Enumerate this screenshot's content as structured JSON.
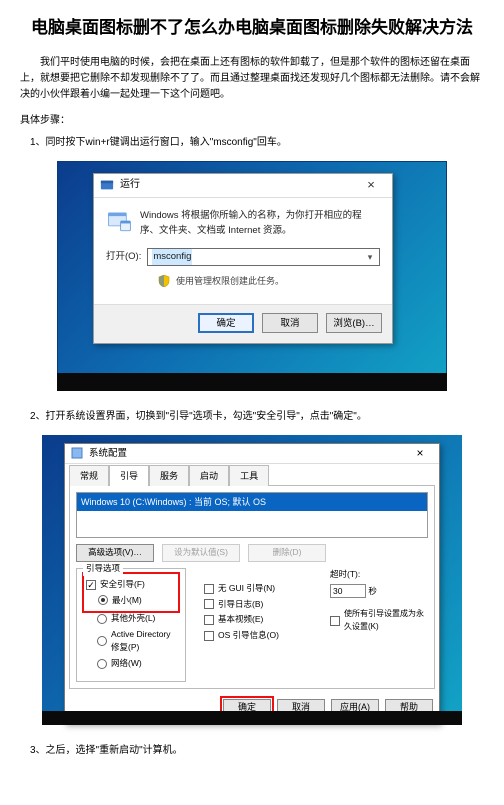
{
  "article": {
    "title": "电脑桌面图标删不了怎么办电脑桌面图标删除失败解决方法",
    "intro": "我们平时使用电脑的时候，会把在桌面上还有图标的软件卸载了，但是那个软件的图标还留在桌面上，就想要把它删除不却发现删除不了了。而且通过整理桌面找还发现好几个图标都无法删除。请不会解决的小伙伴跟着小编一起处理一下这个问题吧。",
    "sect_label": "具体步骤：",
    "step1": "1、同时按下win+r键调出运行窗口，输入\"msconfig\"回车。",
    "step2": "2、打开系统设置界面，切换到\"引导\"选项卡，勾选\"安全引导\"，点击\"确定\"。",
    "step3": "3、之后，选择\"重新启动\"计算机。"
  },
  "run_dialog": {
    "title": "运行",
    "close": "×",
    "desc": "Windows 将根据你所输入的名称，为你打开相应的程序、文件夹、文档或 Internet 资源。",
    "open_label": "打开(O):",
    "value": "msconfig",
    "shield_text": "使用管理权限创建此任务。",
    "ok": "确定",
    "cancel": "取消",
    "browse": "浏览(B)…"
  },
  "syscfg": {
    "title": "系统配置",
    "close": "×",
    "tabs": {
      "t0": "常规",
      "t1": "引导",
      "t2": "服务",
      "t3": "启动",
      "t4": "工具"
    },
    "boot_entry": "Windows 10 (C:\\Windows) : 当前 OS; 默认 OS",
    "mid_btns": {
      "advanced": "高级选项(V)…",
      "default": "设为默认值(S)",
      "delete": "删除(D)"
    },
    "grp_boot": {
      "legend": "引导选项",
      "safe": "安全引导(F)",
      "min": "最小(M)",
      "altshell": "其他外壳(L)",
      "ad": "Active Directory 修复(P)",
      "net": "网络(W)"
    },
    "grp_adv": {
      "nogui": "无 GUI 引导(N)",
      "bootlog": "引导日志(B)",
      "basevideo": "基本视频(E)",
      "osinfo": "OS 引导信息(O)"
    },
    "grp_timeout": {
      "legend": "超时(T):",
      "value": "30",
      "sec": "秒",
      "perm": "使所有引导设置成为永久设置(K)"
    },
    "btns": {
      "ok": "确定",
      "cancel": "取消",
      "apply": "应用(A)",
      "help": "帮助"
    }
  }
}
